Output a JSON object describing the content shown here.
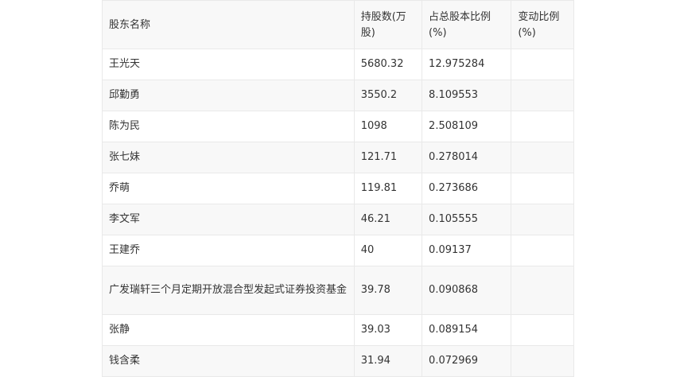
{
  "table": {
    "headers": [
      "股东名称",
      "持股数(万股)",
      "占总股本比例(%)",
      "变动比例(%)"
    ],
    "rows": [
      {
        "name": "王光天",
        "shares": "5680.32",
        "ratio": "12.975284",
        "change": ""
      },
      {
        "name": "邱勤勇",
        "shares": "3550.2",
        "ratio": "8.109553",
        "change": ""
      },
      {
        "name": "陈为民",
        "shares": "1098",
        "ratio": "2.508109",
        "change": ""
      },
      {
        "name": "张七妹",
        "shares": "121.71",
        "ratio": "0.278014",
        "change": ""
      },
      {
        "name": "乔萌",
        "shares": "119.81",
        "ratio": "0.273686",
        "change": ""
      },
      {
        "name": "李文军",
        "shares": "46.21",
        "ratio": "0.105555",
        "change": ""
      },
      {
        "name": "王建乔",
        "shares": "40",
        "ratio": "0.09137",
        "change": ""
      },
      {
        "name": "广发瑞轩三个月定期开放混合型发起式证券投资基金",
        "shares": "39.78",
        "ratio": "0.090868",
        "change": ""
      },
      {
        "name": "张静",
        "shares": "39.03",
        "ratio": "0.089154",
        "change": ""
      },
      {
        "name": "钱含柔",
        "shares": "31.94",
        "ratio": "0.072969",
        "change": ""
      }
    ]
  }
}
